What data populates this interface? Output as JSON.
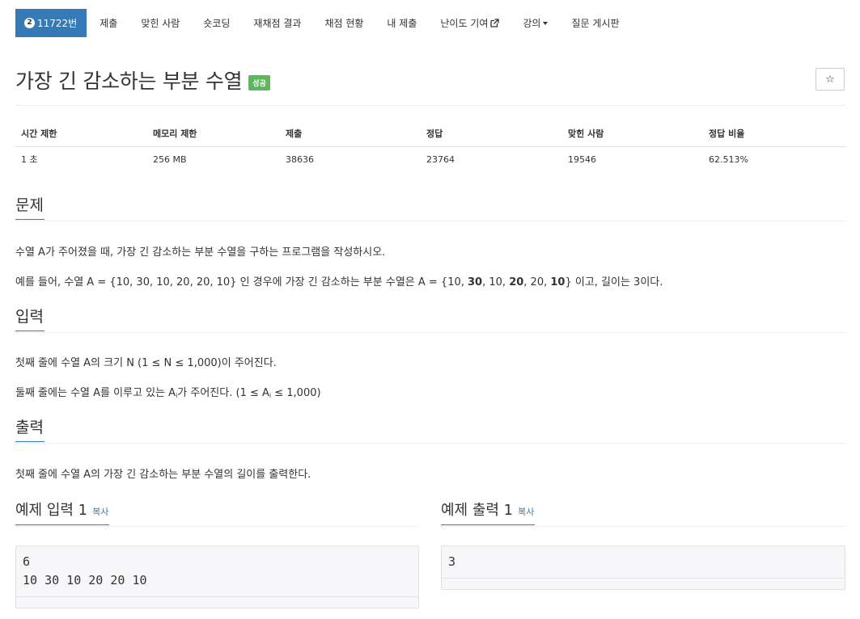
{
  "nav": {
    "active": {
      "icon": "level-badge-icon",
      "badge_char": "2",
      "label": "11722번"
    },
    "items": [
      {
        "label": "제출"
      },
      {
        "label": "맞힌 사람"
      },
      {
        "label": "숏코딩"
      },
      {
        "label": "재채점 결과"
      },
      {
        "label": "채점 현황"
      },
      {
        "label": "내 제출"
      },
      {
        "label": "난이도 기여",
        "icon": "external-link-icon"
      },
      {
        "label": "강의",
        "icon": "caret-down-icon"
      },
      {
        "label": "질문 게시판"
      }
    ]
  },
  "problem": {
    "title": "가장 긴 감소하는 부분 수열",
    "status_badge": "성공",
    "star_icon": "☆"
  },
  "stats": {
    "headers": [
      "시간 제한",
      "메모리 제한",
      "제출",
      "정답",
      "맞힌 사람",
      "정답 비율"
    ],
    "values": [
      "1 초",
      "256 MB",
      "38636",
      "23764",
      "19546",
      "62.513%"
    ]
  },
  "sections": {
    "problem_head": "문제",
    "problem_p1": "수열 A가 주어졌을 때, 가장 긴 감소하는 부분 수열을 구하는 프로그램을 작성하시오.",
    "problem_p2": {
      "prefix": "예를 들어, 수열 A = {10, 30, 10, 20, 20, 10} 인 경우에 가장 긴 감소하는 부분 수열은 A = {10, ",
      "b1": "30",
      "m1": ", 10, ",
      "b2": "20",
      "m2": ", 20, ",
      "b3": "10",
      "suffix": "}  이고, 길이는 3이다."
    },
    "input_head": "입력",
    "input_p1": "첫째 줄에 수열 A의 크기 N (1 ≤ N ≤ 1,000)이 주어진다.",
    "input_p2": {
      "a": "둘째 줄에는 수열 A를 이루고 있는 A",
      "sub1": "i",
      "b": "가 주어진다. (1 ≤ A",
      "sub2": "i",
      "c": " ≤ 1,000)"
    },
    "output_head": "출력",
    "output_p1": "첫째 줄에 수열 A의 가장 긴 감소하는 부분 수열의 길이를 출력한다."
  },
  "samples": {
    "input_head": "예제 입력 1",
    "output_head": "예제 출력 1",
    "copy_label": "복사",
    "input_text": "6\n10 30 10 20 20 10",
    "output_text": "3"
  },
  "colors": {
    "accent": "#337ab7",
    "success": "#5cb85c"
  }
}
